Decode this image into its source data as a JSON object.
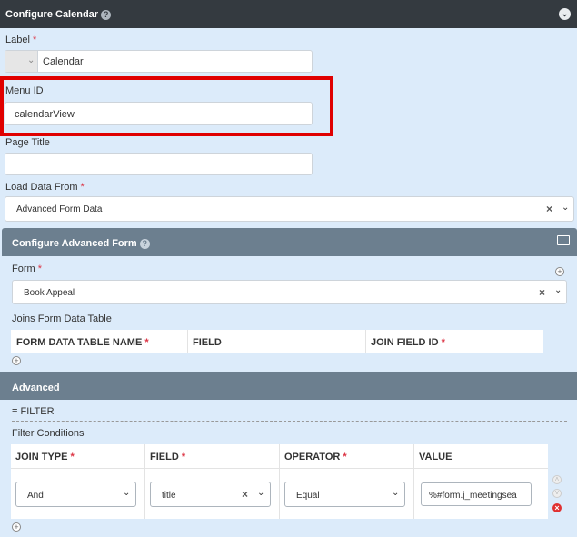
{
  "header": {
    "title": "Configure Calendar"
  },
  "label_field": {
    "label": "Label",
    "value": "Calendar"
  },
  "menu_id": {
    "label": "Menu ID",
    "value": "calendarView"
  },
  "page_title": {
    "label": "Page Title",
    "value": ""
  },
  "load_data": {
    "label": "Load Data From",
    "value": "Advanced Form Data"
  },
  "advanced_form": {
    "title": "Configure Advanced Form",
    "form_label": "Form",
    "form_value": "Book Appeal",
    "joins_label": "Joins Form Data Table",
    "columns": [
      "FORM DATA TABLE NAME",
      "FIELD",
      "JOIN FIELD ID"
    ]
  },
  "advanced": {
    "title": "Advanced",
    "filter_label": "FILTER",
    "conditions_label": "Filter Conditions",
    "columns": [
      "JOIN TYPE",
      "FIELD",
      "OPERATOR",
      "VALUE"
    ],
    "row": {
      "join_type": "And",
      "field": "title",
      "operator": "Equal",
      "value": "%#form.j_meetingsea"
    }
  },
  "required_mark": "*",
  "colors": {
    "topbar": "#343a40",
    "subbar": "#6c7f8f",
    "background": "#dcebfa",
    "highlight": "#e00000",
    "required": "#dc3545"
  }
}
